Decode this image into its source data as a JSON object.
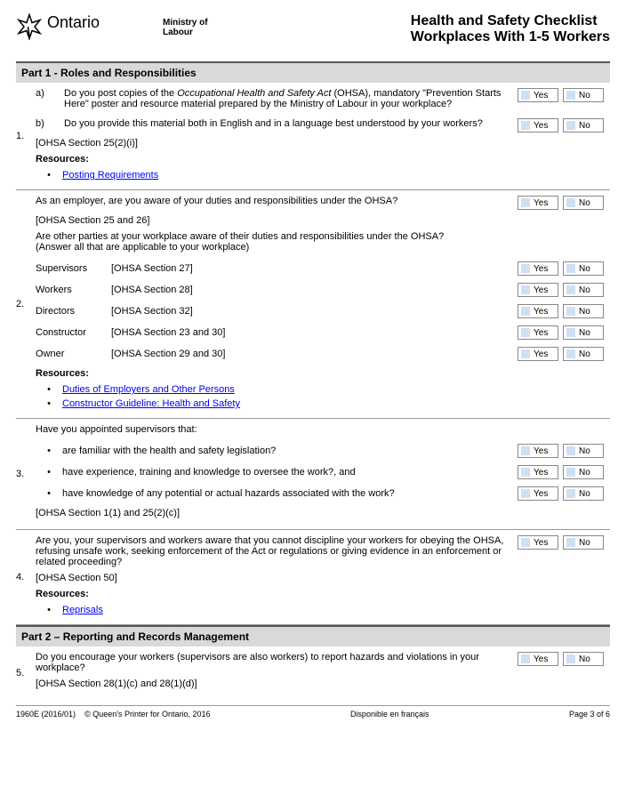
{
  "header": {
    "ontario": "Ontario",
    "ministry": "Ministry of\nLabour",
    "title1": "Health and Safety Checklist",
    "title2": "Workplaces With 1-5 Workers"
  },
  "part1": {
    "title": "Part 1 - Roles and Responsibilities"
  },
  "yes": "Yes",
  "no": "No",
  "q1": {
    "num": "1.",
    "a": "a)",
    "a_text_pre": "Do you post copies of the ",
    "a_text_em": "Occupational Health and Safety Act",
    "a_text_post": " (OHSA), mandatory \"Prevention Starts Here\" poster and resource material prepared by the Ministry of Labour in your workplace?",
    "b": "b)",
    "b_text": "Do you provide this material both in English and in a language best understood by your workers?",
    "ref": "[OHSA Section 25(2)(i)]",
    "res": "Resources:",
    "link1": "Posting Requirements"
  },
  "q2": {
    "num": "2.",
    "line1": "As an employer, are you aware of your duties and responsibilities under the OHSA?",
    "ref1": "[OHSA Section 25 and 26]",
    "line2": "Are other parties at your workplace aware of their duties and responsibilities under the OHSA?\n(Answer all that are applicable to your workplace)",
    "rows": [
      {
        "label": "Supervisors",
        "sect": "[OHSA Section 27]"
      },
      {
        "label": "Workers",
        "sect": "[OHSA Section 28]"
      },
      {
        "label": "Directors",
        "sect": "[OHSA Section 32]"
      },
      {
        "label": "Constructor",
        "sect": "[OHSA Section 23 and 30]"
      },
      {
        "label": "Owner",
        "sect": "[OHSA Section 29 and 30]"
      }
    ],
    "res": "Resources:",
    "link1": "Duties of Employers and Other Persons",
    "link2": "Constructor Guideline: Health and Safety"
  },
  "q3": {
    "num": "3.",
    "intro": "Have you appointed supervisors that:",
    "rows": [
      "are familiar with the health and safety legislation?",
      "have experience, training and knowledge to oversee the work?, and",
      "have knowledge of any potential or actual hazards associated with the work?"
    ],
    "ref": "[OHSA Section 1(1) and 25(2)(c)]"
  },
  "q4": {
    "num": "4.",
    "text": "Are you, your supervisors and workers aware that you cannot discipline your workers for obeying the OHSA, refusing unsafe work, seeking enforcement of the Act or regulations or giving evidence in an enforcement or related proceeding?",
    "ref": "[OHSA Section 50]",
    "res": "Resources:",
    "link1": "Reprisals"
  },
  "part2": {
    "title": "Part 2 – Reporting and Records Management"
  },
  "q5": {
    "num": "5.",
    "text": "Do you encourage your workers (supervisors are also workers) to report hazards and violations in your workplace?",
    "ref": "[OHSA Section 28(1)(c) and 28(1)(d)]"
  },
  "footer": {
    "left": "1960E (2016/01)",
    "mid": "© Queen's Printer for Ontario, 2016",
    "center": "Disponible en français",
    "right": "Page 3 of 6"
  }
}
